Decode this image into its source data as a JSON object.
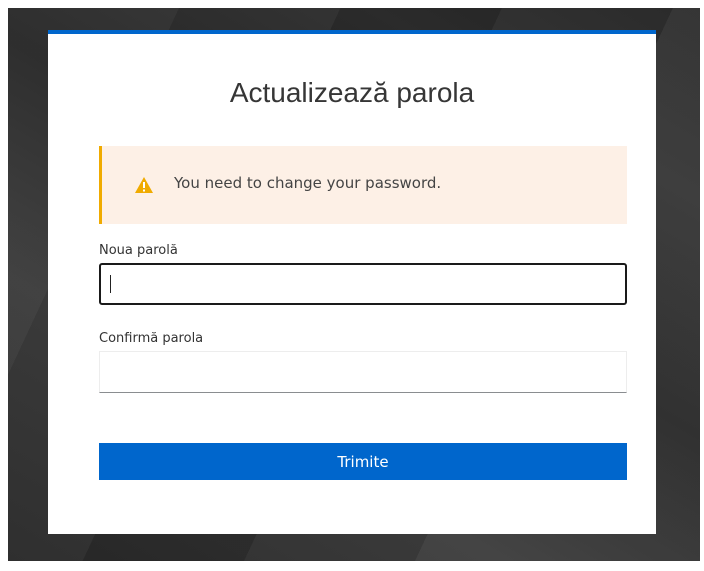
{
  "page": {
    "title": "Actualizează parola"
  },
  "alert": {
    "icon": "warning-icon",
    "message": "You need to change your password.",
    "accent_color": "#f0ab00",
    "background_color": "#fdf0e6"
  },
  "form": {
    "new_password": {
      "label": "Noua parolă",
      "value": ""
    },
    "confirm_password": {
      "label": "Confirmă parola",
      "value": ""
    },
    "submit_label": "Trimite"
  },
  "colors": {
    "primary": "#0066cc",
    "card_accent": "#0066cc"
  }
}
